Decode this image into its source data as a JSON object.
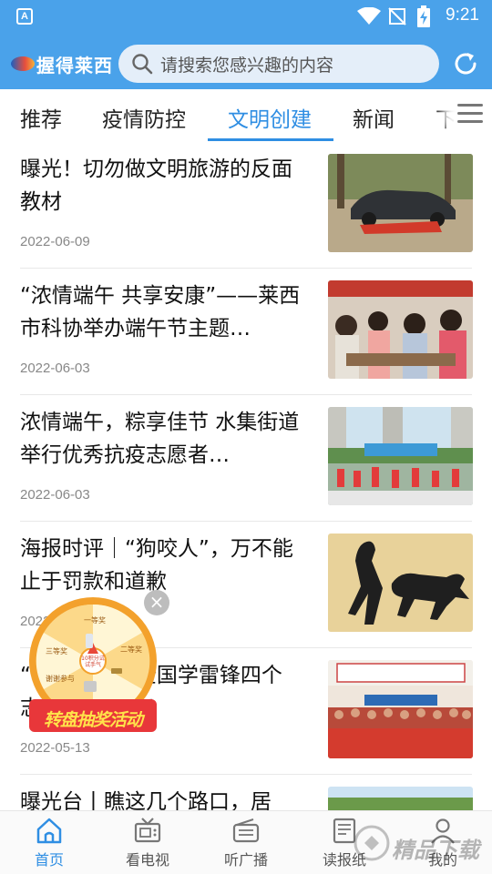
{
  "status_bar": {
    "app_indicator": "A",
    "time": "9:21",
    "icons": [
      "wifi-icon",
      "no-signal-icon",
      "battery-charging-icon"
    ]
  },
  "header": {
    "logo_text": "握得莱西",
    "search_placeholder": "请搜索您感兴趣的内容",
    "refresh_icon": "refresh-icon"
  },
  "tabs": {
    "items": [
      {
        "label": "推荐",
        "active": false
      },
      {
        "label": "疫情防控",
        "active": false
      },
      {
        "label": "文明创建",
        "active": true
      },
      {
        "label": "新闻",
        "active": false
      },
      {
        "label": "下",
        "active": false
      }
    ],
    "menu_icon": "hamburger-menu-icon"
  },
  "articles": [
    {
      "title": "曝光！切勿做文明旅游的反面教材",
      "date": "2022-06-09"
    },
    {
      "title": "“浓情端午 共享安康”——莱西市科协举办端午节主题…",
      "date": "2022-06-03"
    },
    {
      "title": "浓情端午，粽享佳节 水集街道举行优秀抗疫志愿者…",
      "date": "2022-06-03"
    },
    {
      "title": "海报时评｜“狗咬人”，万不能止于罚款和道歉",
      "date": "2022"
    },
    {
      "title": "“　　　　　全国学雷锋四个　　　　志愿服务组织！",
      "date": "2022-05-13"
    },
    {
      "title": "曝光台丨瞧这几个路口，居",
      "date": ""
    }
  ],
  "promo": {
    "banner_text": "转盘抽奖活动",
    "prizes": [
      "一等奖",
      "二等奖",
      "三等奖",
      "谢谢参与"
    ],
    "center_text": "10积分试试手气",
    "close_symbol": "×"
  },
  "bottom_nav": [
    {
      "label": "首页",
      "icon": "home-icon",
      "active": true
    },
    {
      "label": "看电视",
      "icon": "tv-icon",
      "active": false
    },
    {
      "label": "听广播",
      "icon": "radio-icon",
      "active": false
    },
    {
      "label": "读报纸",
      "icon": "newspaper-icon",
      "active": false
    },
    {
      "label": "我的",
      "icon": "user-icon",
      "active": false
    }
  ],
  "watermark_text": "精品下载",
  "colors": {
    "brand_blue": "#4aa2ea",
    "accent_blue": "#2f8ee3"
  }
}
